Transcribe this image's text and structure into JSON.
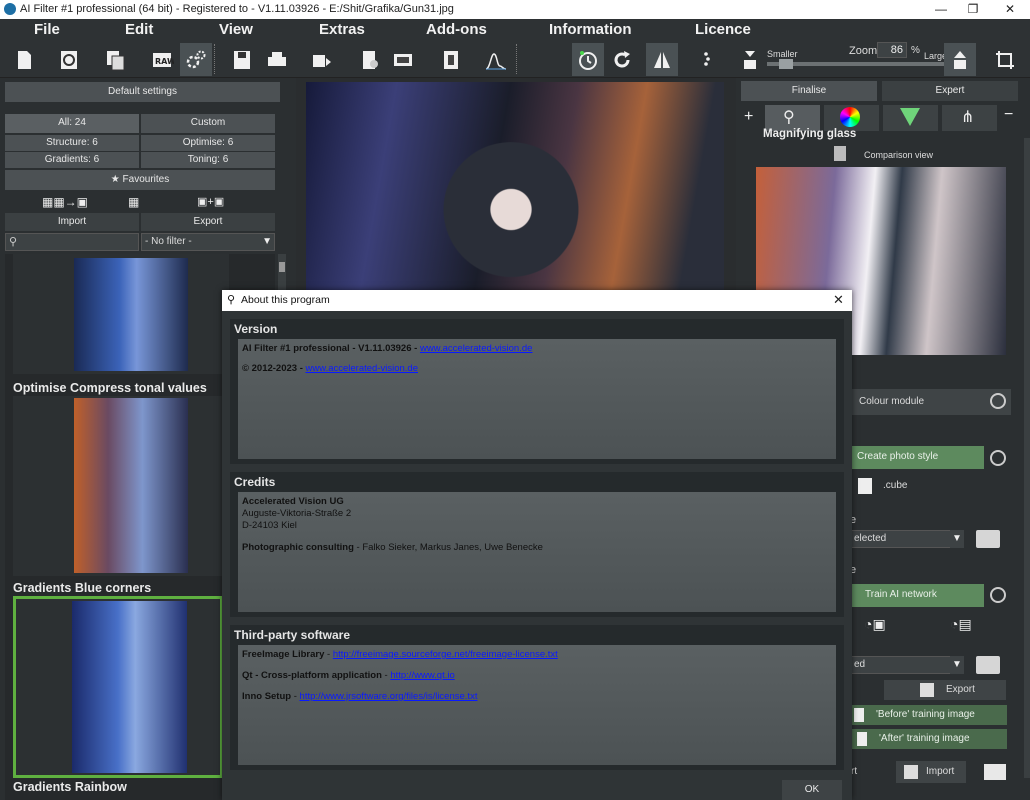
{
  "window": {
    "title": "AI Filter #1 professional (64 bit) - Registered to - V1.11.03926 - E:/Shit/Grafika/Gun31.jpg",
    "minimize": "—",
    "maximize": "❐",
    "close": "✕"
  },
  "menu": [
    "File",
    "Edit",
    "View",
    "Extras",
    "Add-ons",
    "Information",
    "Licence"
  ],
  "zoom": {
    "label": "Zoom",
    "value": "86",
    "unit": "%",
    "smaller": "Smaller",
    "larger": "Larger"
  },
  "left_panel": {
    "default_settings": "Default settings",
    "filters": {
      "all": "All: 24",
      "custom": "Custom",
      "structure": "Structure: 6",
      "optimise": "Optimise: 6",
      "gradients": "Gradients: 6",
      "toning": "Toning: 6"
    },
    "favourites": "Favourites",
    "import": "Import",
    "export": "Export",
    "filter_select": "- No filter -",
    "thumbnails": [
      {
        "label": "Optimise Compress tonal values"
      },
      {
        "label": "Gradients Blue corners"
      },
      {
        "label": "Gradients Rainbow"
      }
    ]
  },
  "right_panel": {
    "tabs": {
      "finalise": "Finalise",
      "expert": "Expert"
    },
    "magnifying_glass": "Magnifying glass",
    "comparison_view": "Comparison view",
    "colour_module": "Colour module",
    "create_photo_style": "Create photo style",
    "cube": ".cube",
    "selected": "elected",
    "section_letter_1": "e",
    "section_letter_2": "e",
    "train_ai": "Train AI network",
    "ed": "ed",
    "export": "Export",
    "before_training": "'Before' training image",
    "after_training": "'After' training image",
    "rt": "rt",
    "import": "Import"
  },
  "dialog": {
    "title": "About this program",
    "version_heading": "Version",
    "version_line_bold": "AI Filter #1 professional - V1.11.03926 - ",
    "version_link": "www.accelerated-vision.de",
    "copyright_bold": "© 2012-2023 - ",
    "copyright_link": "www.accelerated-vision.de",
    "credits_heading": "Credits",
    "company": "Accelerated Vision UG",
    "street": "Auguste-Viktoria-Straße 2",
    "city": "D-24103 Kiel",
    "consulting_bold": "Photographic consulting",
    "consulting_names": " - Falko Sieker, Markus Janes, Uwe Benecke",
    "third_party_heading": "Third-party software",
    "freeimage_bold": "FreeImage Library",
    "freeimage_link": "http://freeimage.sourceforge.net/freeimage-license.txt",
    "qt_bold": "Qt - Cross-platform application",
    "qt_link": "http://www.qt.io",
    "inno_bold": "Inno Setup",
    "inno_link": "http://www.jrsoftware.org/files/is/license.txt",
    "ok": "OK"
  },
  "colors": {
    "accent_green": "#5fb040",
    "panel": "#2b2f31",
    "link": "#0a1aff"
  }
}
